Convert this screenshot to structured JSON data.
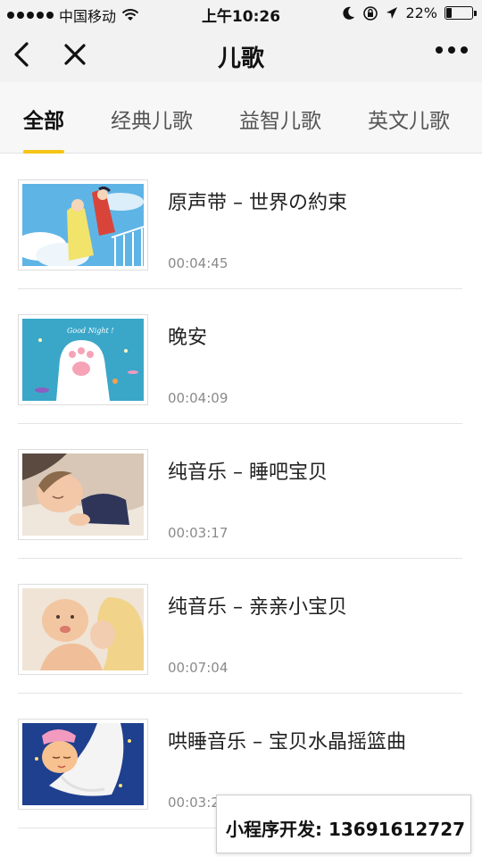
{
  "status_bar": {
    "carrier": "中国移动",
    "time": "上午10:26",
    "battery_percent": "22%",
    "battery_level": 0.22,
    "icons": [
      "signal-dots-icon",
      "wifi-icon",
      "moon-icon",
      "rotation-lock-icon",
      "location-arrow-icon",
      "battery-icon"
    ]
  },
  "nav": {
    "title": "儿歌",
    "icons": [
      "back-chevron-icon",
      "close-icon",
      "more-dots-icon"
    ]
  },
  "tabs": {
    "items": [
      {
        "label": "全部",
        "active": true
      },
      {
        "label": "经典儿歌",
        "active": false
      },
      {
        "label": "益智儿歌",
        "active": false
      },
      {
        "label": "英文儿歌",
        "active": false
      }
    ],
    "accent_color": "#f5c518"
  },
  "songs": [
    {
      "title": "原声带 – 世界の約束",
      "duration": "00:04:45",
      "thumb": "sky-girl-balcony"
    },
    {
      "title": "晚安",
      "duration": "00:04:09",
      "thumb": "good-night-paw",
      "thumb_text": "Good Night !"
    },
    {
      "title": "纯音乐 – 睡吧宝贝",
      "duration": "00:03:17",
      "thumb": "sleeping-baby"
    },
    {
      "title": "纯音乐 – 亲亲小宝贝",
      "duration": "00:07:04",
      "thumb": "mother-kissing-baby"
    },
    {
      "title": "哄睡音乐 – 宝贝水晶摇篮曲",
      "duration": "00:03:2",
      "thumb": "cartoon-baby-hammock"
    }
  ],
  "banner": {
    "text": "小程序开发: 13691612727"
  }
}
